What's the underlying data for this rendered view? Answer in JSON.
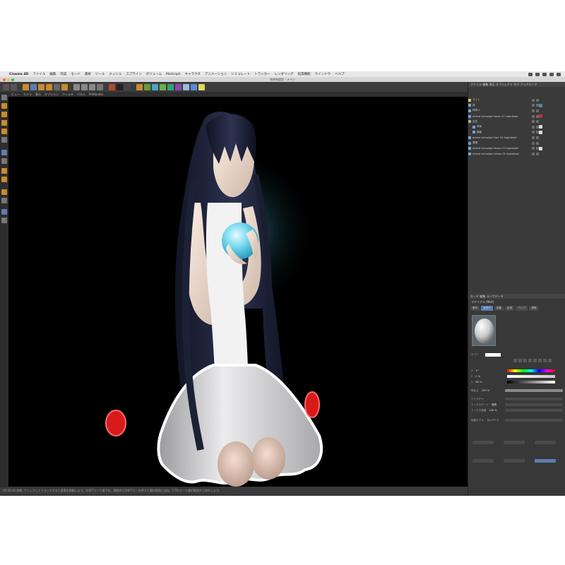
{
  "menubar": {
    "app_name": "Cinema 4D",
    "items": [
      "ファイル",
      "編集",
      "作成",
      "モード",
      "選択",
      "ツール",
      "メッシュ",
      "スプライン",
      "ボリューム",
      "MoGraph",
      "キャラクタ",
      "アニメーション",
      "シミュレート",
      "トラッカー",
      "レンダリング",
      "拡張機能",
      "ウインドウ",
      "ヘルプ"
    ]
  },
  "window": {
    "title": "名称未設定 - メイン"
  },
  "viewport_menu": [
    "ビュー",
    "カメラ",
    "表示",
    "オプション",
    "フィルタ",
    "パネル",
    "ProRender"
  ],
  "statusbar": {
    "time": "00:00:08",
    "text": "移動: クリックしてドラッグすると要素を移動します。SHIFTキーで量子化、移動中にSHIFTキーを押すと選択範囲に追加、CTRLキーで選択範囲から除外します。"
  },
  "object_manager": {
    "tabs": [
      "ファイル",
      "編集",
      "表示",
      "オブジェクト",
      "タグ",
      "ブックマーク"
    ],
    "objects": [
      {
        "name": "ライト"
      },
      {
        "name": "床"
      },
      {
        "name": "球体.1"
      },
      {
        "name": "anime schoolgirl body 01 highdetail"
      },
      {
        "name": "空白"
      },
      {
        "name": "球体"
      },
      {
        "name": "頭髪"
      },
      {
        "name": "anime schoolgirl hair 01 highdetail"
      },
      {
        "name": "環境"
      },
      {
        "name": "anime schoolgirl dress 01 highdetail"
      },
      {
        "name": "anime schoolgirl shoes 01 highdetail"
      }
    ]
  },
  "attribute_manager": {
    "header_tabs": [
      "モード",
      "編集",
      "ユーザデータ"
    ],
    "material_name": "マテリアル [Mat]",
    "tabs": [
      "基本",
      "カラー",
      "拡散",
      "反射",
      "バンプ",
      "透明"
    ],
    "color_label": "カラー",
    "hsv": [
      {
        "label": "H",
        "value": "0°"
      },
      {
        "label": "S",
        "value": "0 %"
      },
      {
        "label": "V",
        "value": "80 %"
      }
    ],
    "brightness_label": "明るさ",
    "brightness_value": "100 %",
    "texture_label": "テクスチャ",
    "mix_label": "ミックスモード",
    "mix_value": "通常",
    "mix_strength_label": "ミックス強度",
    "mix_strength_value": "100 %",
    "model_label": "拡散モデル",
    "model_value": "ランバート"
  },
  "colors": {
    "app_bg": "#333333",
    "viewport_bg": "#000000",
    "accent": "#5b7fb3",
    "hair": "#1a1d2e",
    "dress": "#e9e9ea",
    "shoes": "#d81a1a",
    "orb": "#7fdcf0"
  },
  "scene": {
    "subject": "anime-girl-figure-icon",
    "held_object": "glowing-orb-icon"
  }
}
